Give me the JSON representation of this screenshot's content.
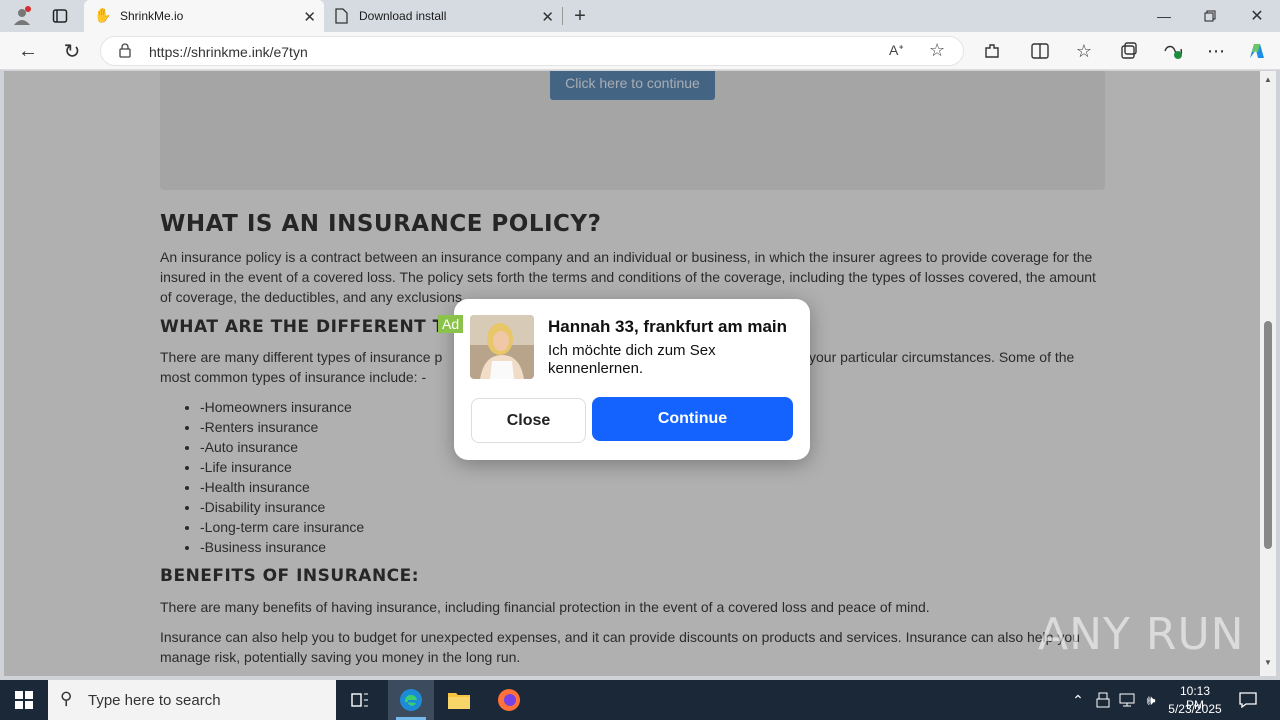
{
  "browser": {
    "tabs": [
      {
        "title": "ShrinkMe.io",
        "active": true
      },
      {
        "title": "Download install",
        "active": false
      }
    ],
    "url": "https://shrinkme.ink/e7tyn",
    "accent": "#0f6cbd"
  },
  "page": {
    "continue_button": "Click here to continue",
    "h_policy": "WHAT IS AN INSURANCE POLICY?",
    "p_policy": "An insurance policy is a contract between an insurance company and an individual or business, in which the insurer agrees to provide coverage for the insured in the event of a covered loss. The policy sets forth the terms and conditions of the coverage, including the types of losses covered, the amount of coverage, the deductibles, and any exclusions.",
    "h_types": "WHAT ARE THE DIFFERENT T",
    "p_types_a": "There are many different types of insurance p",
    "p_types_b": "your particular circumstances. Some of the",
    "p_types_c": "most common types of insurance include: -",
    "insurance_types": [
      "-Homeowners insurance",
      "-Renters insurance",
      "-Auto insurance",
      "-Life insurance",
      "-Health insurance",
      "-Disability insurance",
      "-Long-term care insurance",
      "-Business insurance"
    ],
    "h_benefits": "BENEFITS OF INSURANCE:",
    "p_benefits_1": "There are many benefits of having insurance, including financial protection in the event of a covered loss and peace of mind.",
    "p_benefits_2": "Insurance can also help you to budget for unexpected expenses, and it can provide discounts on products and services. Insurance can also help you manage risk, potentially saving you money in the long run."
  },
  "ad": {
    "badge": "Ad",
    "title": "Hannah 33, frankfurt am main",
    "message": "Ich möchte dich zum Sex kennenlernen.",
    "close_label": "Close",
    "continue_label": "Continue",
    "continue_color": "#1463ff"
  },
  "watermark": "ANY RUN",
  "taskbar": {
    "search_placeholder": "Type here to search",
    "time": "10:13 PM",
    "date": "5/23/2025"
  }
}
